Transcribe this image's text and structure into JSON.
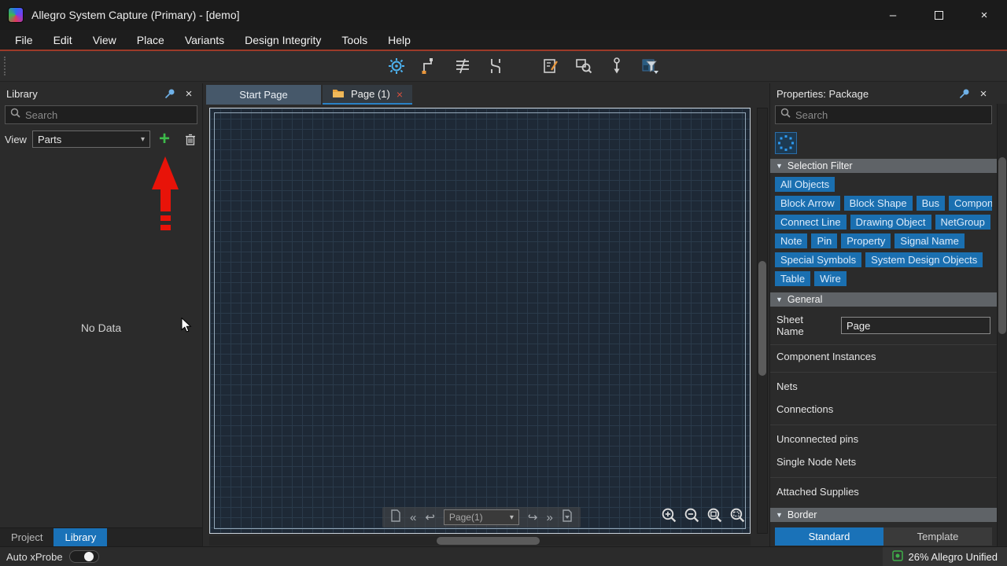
{
  "window": {
    "app_title": "Allegro System Capture (Primary) - [demo]",
    "controls": {
      "minimize": "–",
      "close": "×"
    }
  },
  "glyphs": {
    "close_x": "×",
    "dropdown": "▾",
    "section_triangle": "▼",
    "nav_first": "«",
    "nav_last": "»",
    "nav_prev": "↩",
    "nav_next": "↪"
  },
  "menu": {
    "items": [
      "File",
      "Edit",
      "View",
      "Place",
      "Variants",
      "Design Integrity",
      "Tools",
      "Help"
    ]
  },
  "toolbar": {
    "icons": [
      "probe-settings-icon",
      "trace-wire-icon",
      "bus-wires-icon",
      "swap-wire-icon",
      "markup-note-icon",
      "search-net-icon",
      "probe-pin-icon",
      "selection-filter-icon"
    ]
  },
  "library_panel": {
    "title": "Library",
    "search_placeholder": "Search",
    "view_label": "View",
    "view_value": "Parts",
    "empty_text": "No Data",
    "tabs": [
      "Project",
      "Library"
    ]
  },
  "canvas": {
    "tabs": [
      "Start Page",
      "Page (1)"
    ],
    "page_nav_value": "Page(1)"
  },
  "properties_panel": {
    "title": "Properties: Package",
    "search_placeholder": "Search",
    "selection_filter": {
      "title": "Selection Filter",
      "chips": [
        "All Objects",
        "Block Arrow",
        "Block Shape",
        "Bus",
        "Compon",
        "Connect Line",
        "Drawing Object",
        "NetGroup",
        "Note",
        "Pin",
        "Property",
        "Signal Name",
        "Special Symbols",
        "System Design Objects",
        "Table",
        "Wire"
      ]
    },
    "general": {
      "title": "General",
      "sheet_name_label": "Sheet Name",
      "sheet_name_value": "Page",
      "rows": [
        "Component Instances",
        "Nets",
        "Connections",
        "Unconnected pins",
        "Single Node Nets",
        "Attached Supplies"
      ]
    },
    "border": {
      "title": "Border",
      "standard_label": "Standard",
      "template_label": "Template"
    }
  },
  "status_bar": {
    "auto_xprobe_label": "Auto xProbe",
    "zoom_status": "26% Allegro Unified"
  },
  "colors": {
    "accent_blue": "#1a72b8",
    "chip_blue": "#1a6fb0",
    "annotation_red": "#e81309",
    "menu_underline_red": "#9c3a28",
    "canvas_bg": "#1e2936"
  }
}
